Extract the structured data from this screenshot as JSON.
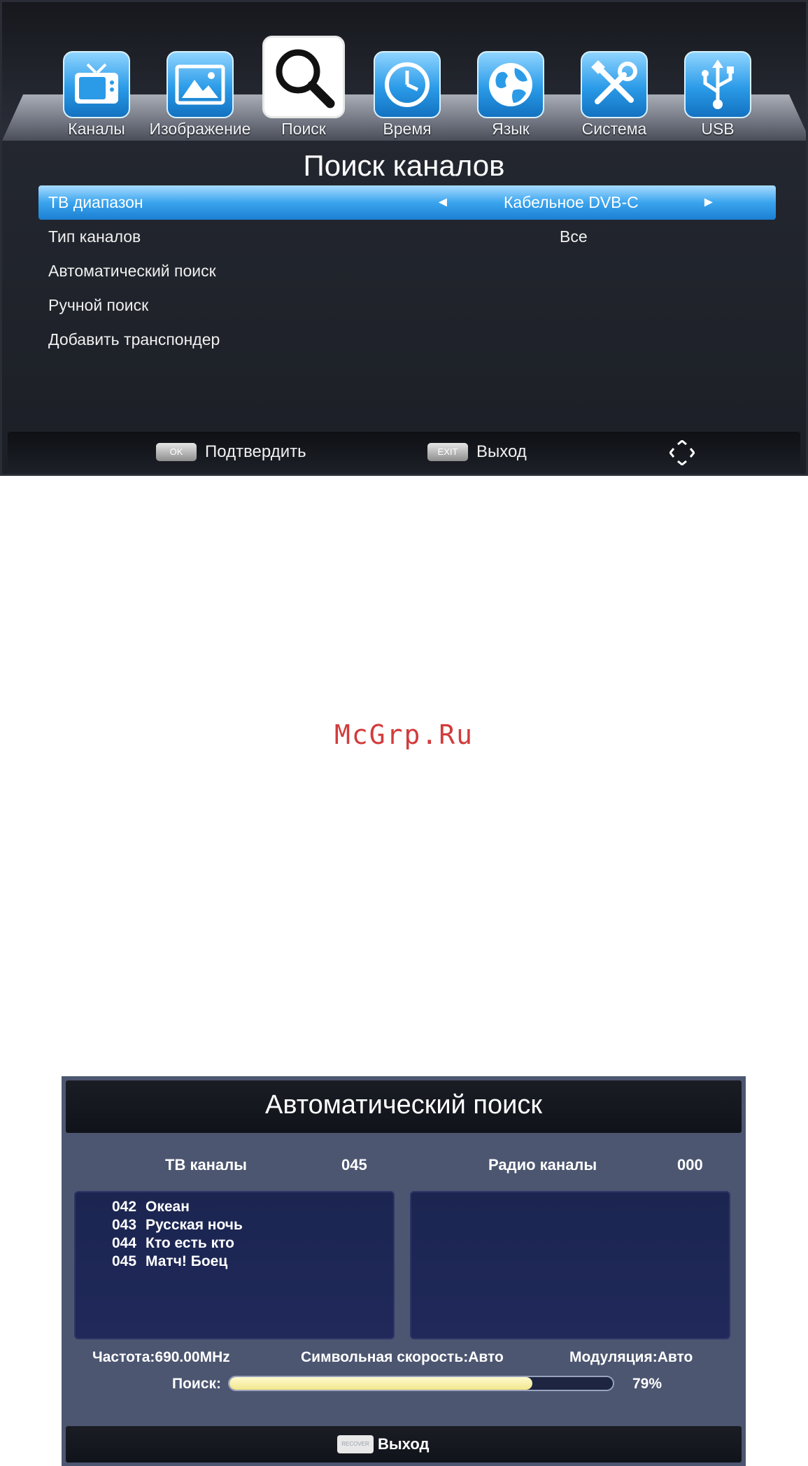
{
  "screen1": {
    "tabs": [
      {
        "label": "Каналы",
        "icon": "tv-icon"
      },
      {
        "label": "Изображение",
        "icon": "picture-icon"
      },
      {
        "label": "Поиск",
        "icon": "search-icon",
        "active": true
      },
      {
        "label": "Время",
        "icon": "clock-icon"
      },
      {
        "label": "Язык",
        "icon": "globe-icon"
      },
      {
        "label": "Система",
        "icon": "tools-icon"
      },
      {
        "label": "USB",
        "icon": "usb-icon"
      }
    ],
    "title": "Поиск каналов",
    "menu": [
      {
        "label": "ТВ диапазон",
        "value": "Кабельное DVB-C"
      },
      {
        "label": "Тип каналов",
        "value": "Все"
      },
      {
        "label": "Автоматический поиск",
        "value": ""
      },
      {
        "label": "Ручной поиск",
        "value": ""
      },
      {
        "label": "Добавить транспондер",
        "value": ""
      }
    ],
    "footer": {
      "ok_key": "OK",
      "ok_label": "Подтвердить",
      "exit_key": "EXIT",
      "exit_label": "Выход"
    }
  },
  "watermark": "McGrp.Ru",
  "screen2": {
    "title": "Автоматический поиск",
    "tv_label": "ТВ каналы",
    "tv_count": "045",
    "radio_label": "Радио каналы",
    "radio_count": "000",
    "tv_list": [
      {
        "num": "042",
        "name": "Океан"
      },
      {
        "num": "043",
        "name": "Русская ночь"
      },
      {
        "num": "044",
        "name": "Кто есть кто"
      },
      {
        "num": "045",
        "name": "Матч! Боец"
      }
    ],
    "frequency": "Частота:690.00MHz",
    "symbol_rate": "Символьная скорость:Авто",
    "modulation": "Модуляция:Авто",
    "search_label": "Поиск:",
    "progress_text": "79%",
    "progress_fraction": 0.79,
    "footer_key": "RECOVER",
    "footer_label": "Выход"
  },
  "colors": {
    "accent_blue": "#2b9be8",
    "selection_bar": "#3aa4ee",
    "progress_fill": "#f1e68a",
    "watermark": "#d23b3b"
  }
}
